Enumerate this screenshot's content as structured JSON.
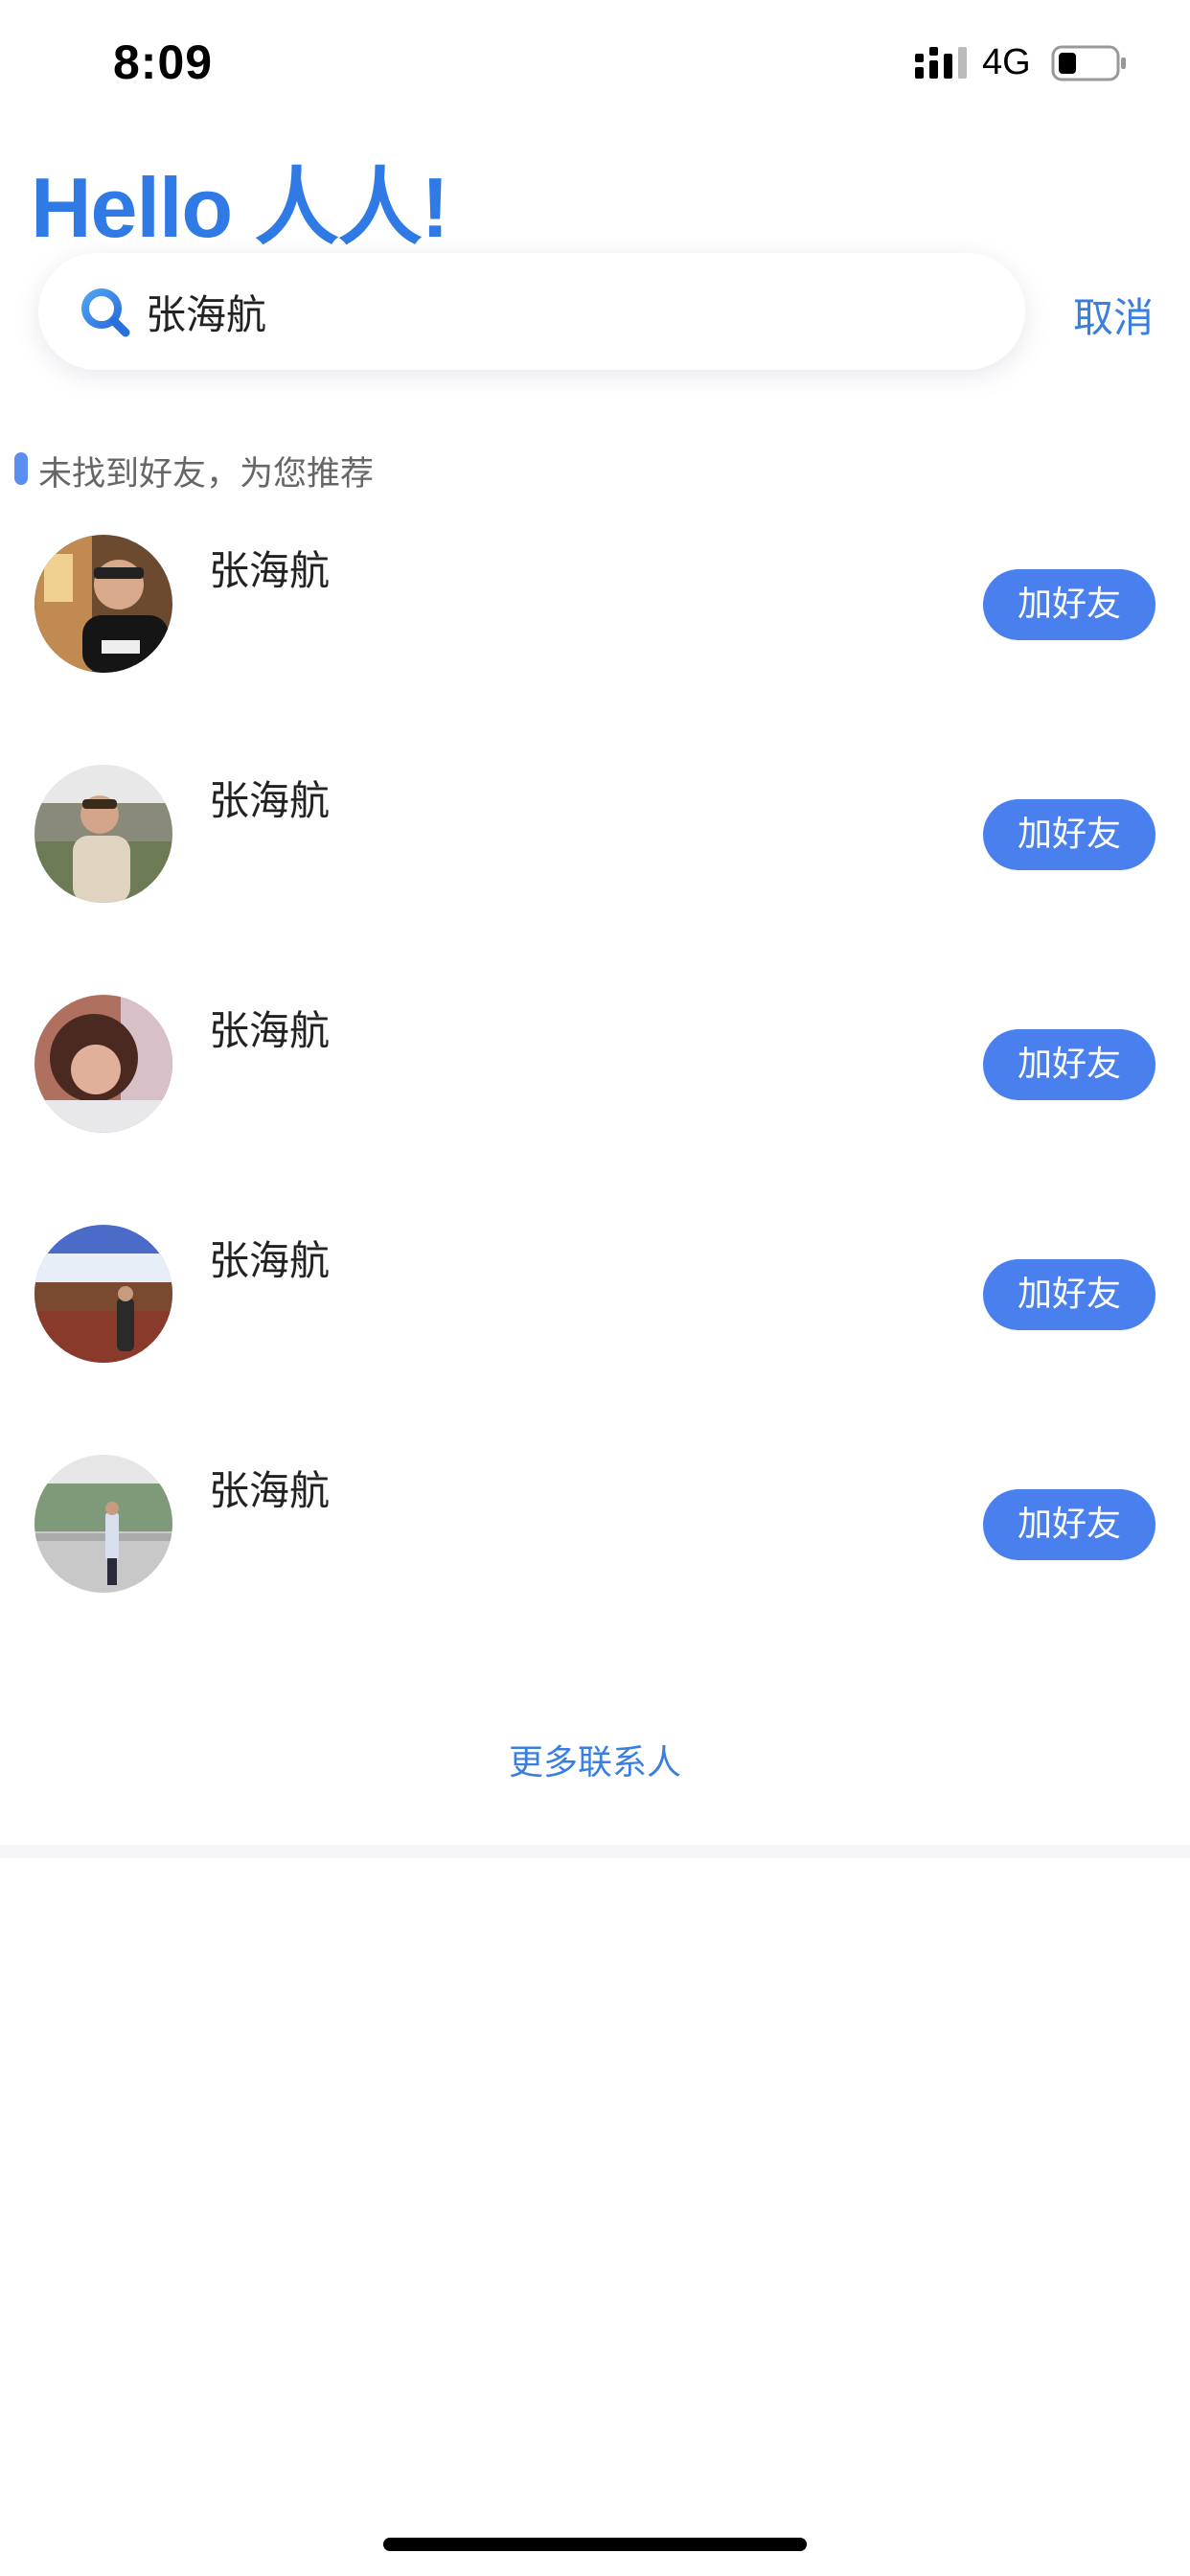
{
  "status_bar": {
    "time": "8:09",
    "network": "4G",
    "signal_icon": "signal-bars-icon",
    "battery_icon": "battery-icon",
    "battery_level": 0.3
  },
  "header": {
    "title": "Hello 人人!"
  },
  "search": {
    "value": "张海航",
    "icon": "search-icon",
    "cancel_label": "取消"
  },
  "section": {
    "label": "未找到好友，为您推荐"
  },
  "results": [
    {
      "name": "张海航",
      "button_label": "加好友"
    },
    {
      "name": "张海航",
      "button_label": "加好友"
    },
    {
      "name": "张海航",
      "button_label": "加好友"
    },
    {
      "name": "张海航",
      "button_label": "加好友"
    },
    {
      "name": "张海航",
      "button_label": "加好友"
    }
  ],
  "more_contacts_label": "更多联系人",
  "colors": {
    "accent": "#2f7ae5",
    "button": "#4a80ee",
    "link": "#3a7fe0"
  }
}
